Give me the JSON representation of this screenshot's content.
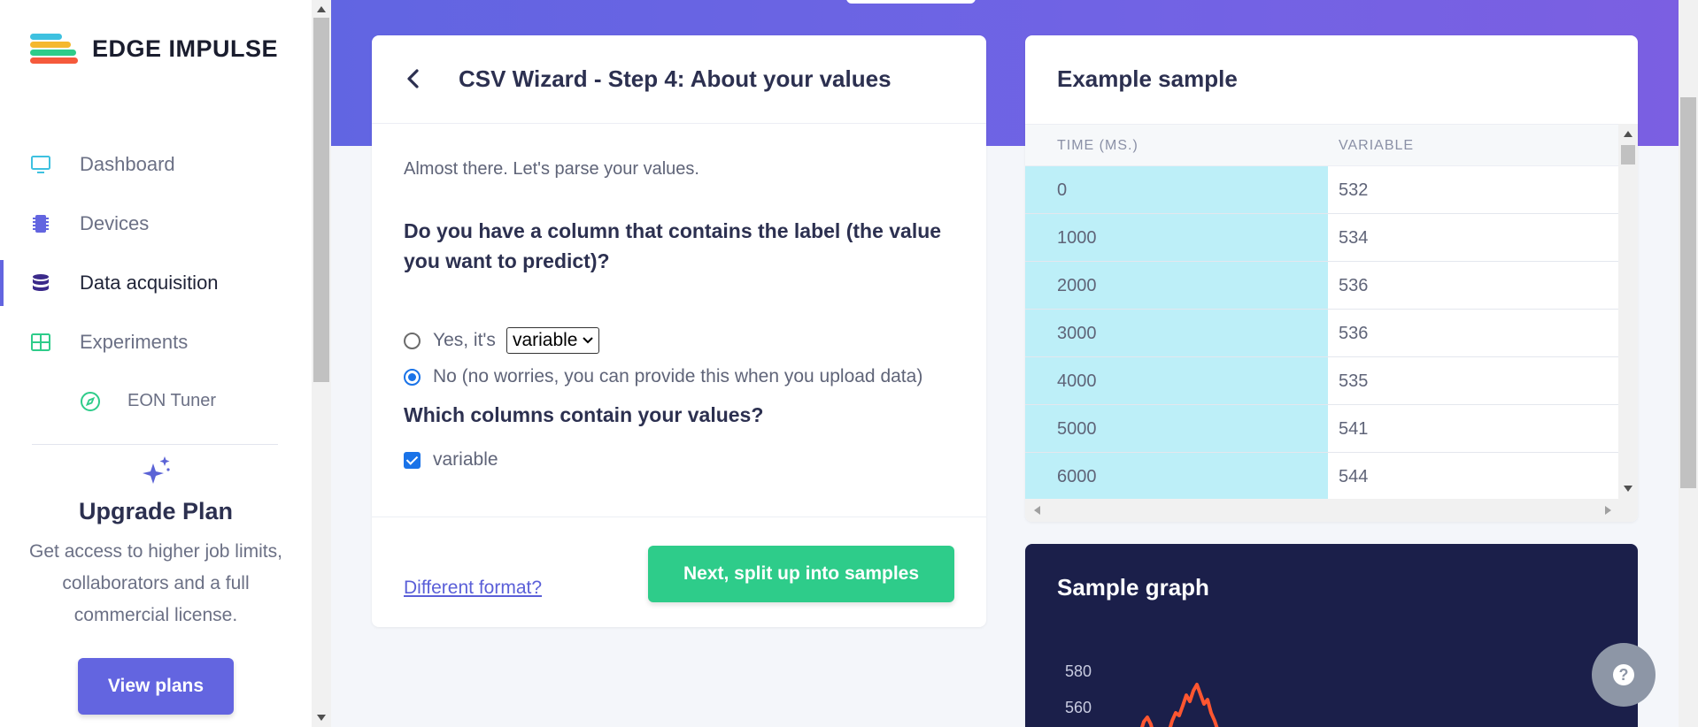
{
  "brand": {
    "name": "EDGE IMPULSE"
  },
  "sidebar": {
    "items": [
      {
        "label": "Dashboard",
        "icon": "monitor-icon"
      },
      {
        "label": "Devices",
        "icon": "chip-icon"
      },
      {
        "label": "Data acquisition",
        "icon": "database-icon",
        "active": true
      },
      {
        "label": "Experiments",
        "icon": "table-icon"
      },
      {
        "label": "EON Tuner",
        "icon": "compass-icon"
      }
    ],
    "upgrade": {
      "title": "Upgrade Plan",
      "text": "Get access to higher job limits, collaborators and a full commercial license.",
      "button": "View plans"
    }
  },
  "wizard": {
    "title": "CSV Wizard - Step 4: About your values",
    "intro": "Almost there. Let's parse your values.",
    "label_question": "Do you have a column that contains the label (the value you want to predict)?",
    "option_yes": "Yes, it's",
    "option_yes_select": "variable",
    "option_no": "No (no worries, you can provide this when you upload data)",
    "values_question": "Which columns contain your values?",
    "values_checkbox": "variable",
    "different_format": "Different format?",
    "next_button": "Next, split up into samples"
  },
  "example": {
    "title": "Example sample",
    "columns": [
      "TIME (MS.)",
      "VARIABLE"
    ],
    "rows": [
      [
        "0",
        "532"
      ],
      [
        "1000",
        "534"
      ],
      [
        "2000",
        "536"
      ],
      [
        "3000",
        "536"
      ],
      [
        "4000",
        "535"
      ],
      [
        "5000",
        "541"
      ],
      [
        "6000",
        "544"
      ]
    ]
  },
  "graph": {
    "title": "Sample graph",
    "y_ticks": [
      "580",
      "560"
    ]
  },
  "colors": {
    "accent": "#6365e0",
    "success": "#2ecc8a",
    "highlight_column": "#bdeff8",
    "graph_bg": "#1b1f4a",
    "graph_line": "#ff5630"
  }
}
